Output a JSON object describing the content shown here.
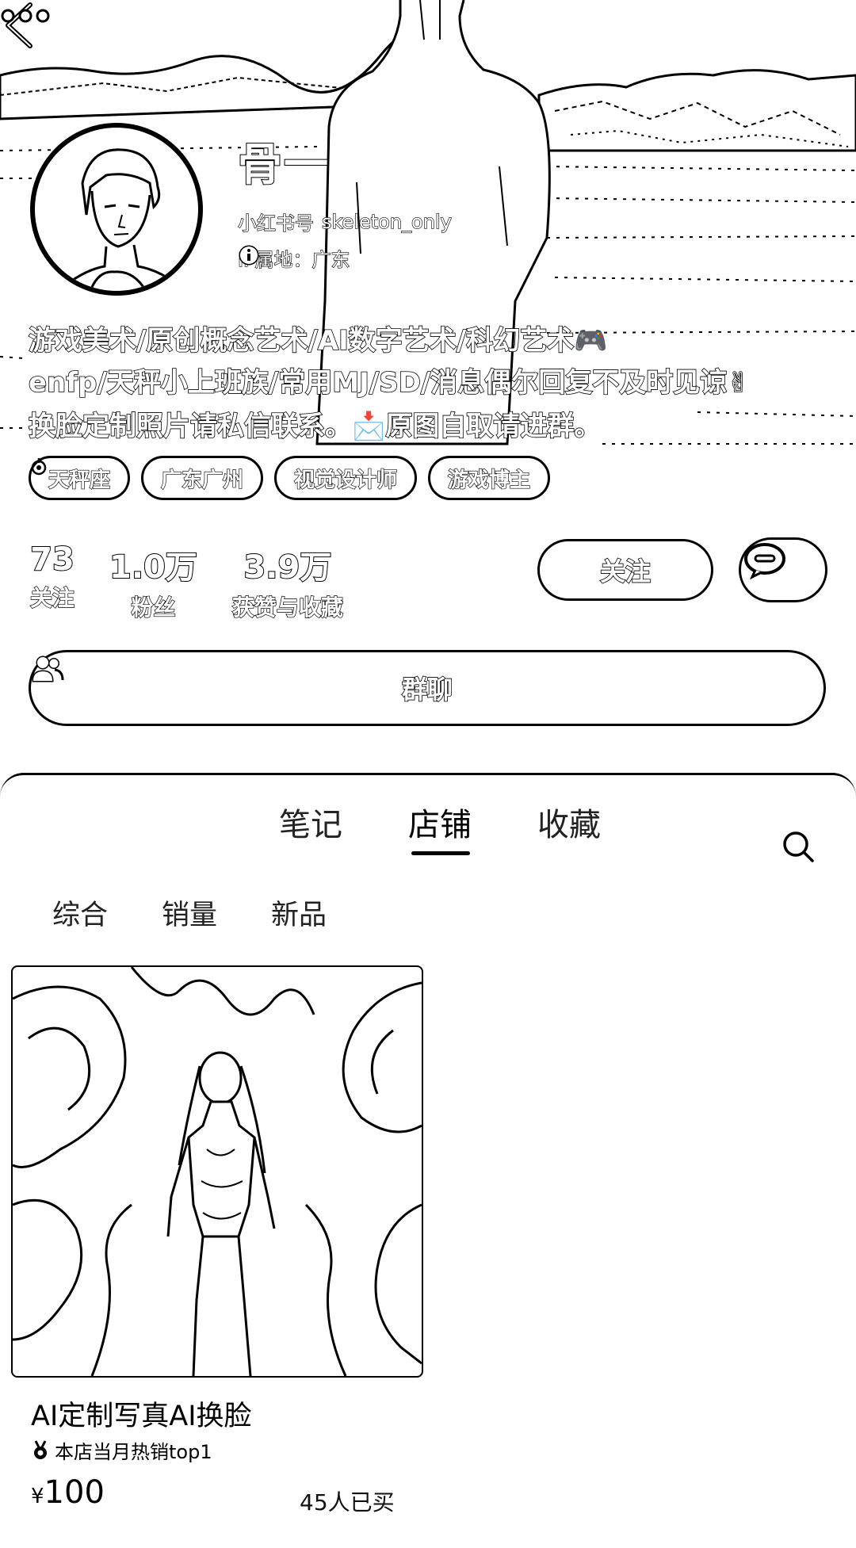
{
  "header": {
    "back_icon": "chevron-left-icon",
    "more_icon": "more-dots-icon"
  },
  "profile": {
    "username": "骨一",
    "id_label": "小红书号",
    "id_value": "skeleton_only",
    "ip_label": "IP属地：广东",
    "bio_lines": [
      "游戏美术/原创概念艺术/AI数字艺术/科幻艺术🎮",
      "enfp/天秤小上班族/常用MJ/SD/消息偶尔回复不及时见谅✌",
      "换脸定制照片请私信联系。📩原图自取请进群。"
    ],
    "tags": [
      {
        "label": "天秤座",
        "icon": "libra-icon"
      },
      {
        "label": "广东广州",
        "icon": ""
      },
      {
        "label": "视觉设计师",
        "icon": ""
      },
      {
        "label": "游戏博主",
        "icon": ""
      }
    ],
    "stats": [
      {
        "value": "73",
        "label": "关注"
      },
      {
        "value": "1.0万",
        "label": "粉丝"
      },
      {
        "value": "3.9万",
        "label": "获赞与收藏"
      }
    ],
    "follow_label": "关注",
    "message_icon": "chat-bubble-icon",
    "group_chat_label": "群聊",
    "group_chat_icon": "people-icon"
  },
  "tabs": {
    "items": [
      "笔记",
      "店铺",
      "收藏"
    ],
    "active": "店铺",
    "search_icon": "search-icon"
  },
  "filters": [
    "综合",
    "销量",
    "新品"
  ],
  "products": [
    {
      "title": "AI定制写真AI换脸",
      "badge": "本店当月热销top1",
      "badge_icon": "medal-icon",
      "price_symbol": "¥",
      "price": "100",
      "sold": "45人已买"
    }
  ]
}
